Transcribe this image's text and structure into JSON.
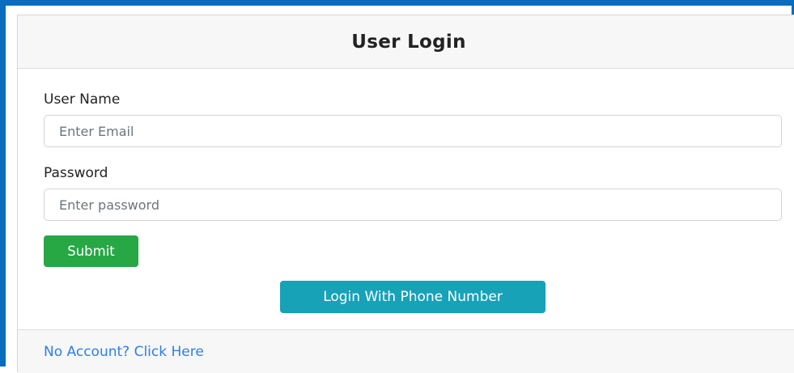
{
  "card": {
    "title": "User Login"
  },
  "form": {
    "username_label": "User Name",
    "email_placeholder": "Enter Email",
    "password_label": "Password",
    "password_placeholder": "Enter password",
    "submit_label": "Submit",
    "phone_login_label": "Login With Phone Number"
  },
  "footer": {
    "signup_link": "No Account? Click Here"
  },
  "colors": {
    "frame_border": "#0a6cbf",
    "submit_bg": "#28a745",
    "phone_bg": "#17a2b8",
    "link": "#2f7ee6"
  }
}
